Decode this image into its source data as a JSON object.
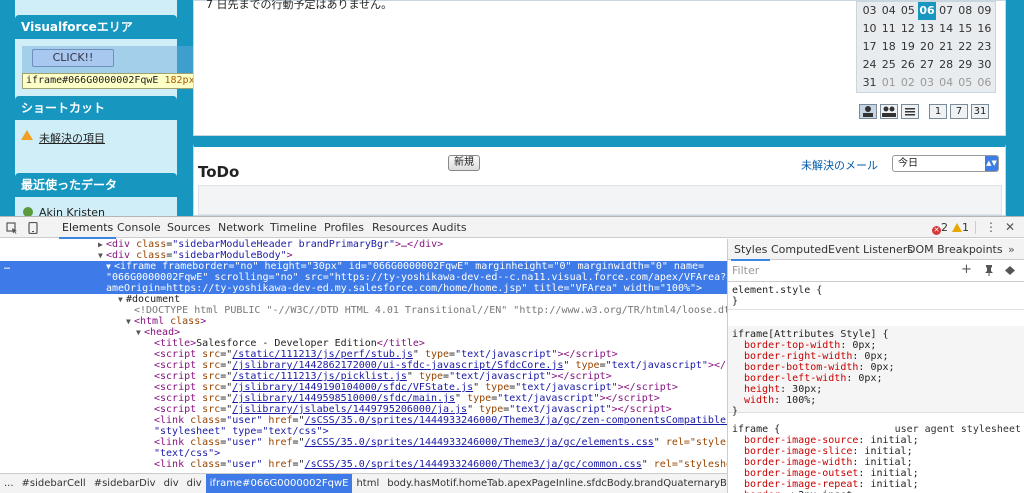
{
  "sidebar": {
    "vf_header": "Visualforceエリア",
    "click_button": "CLICK!!",
    "tooltip": {
      "id": "iframe#066G0000002FqwE",
      "width": "182",
      "height": "30",
      "unit": "px",
      "times": "×"
    },
    "shortcut_header": "ショートカット",
    "shortcut_link": "未解決の項目",
    "recent_header": "最近使ったデータ",
    "recent_item": "Akin Kristen"
  },
  "events": {
    "message": "7 日先までの行動予定はありません。"
  },
  "calendar": {
    "rows": [
      [
        {
          "d": "03"
        },
        {
          "d": "04"
        },
        {
          "d": "05"
        },
        {
          "d": "06",
          "today": true
        },
        {
          "d": "07"
        },
        {
          "d": "08"
        },
        {
          "d": "09"
        }
      ],
      [
        {
          "d": "10"
        },
        {
          "d": "11"
        },
        {
          "d": "12"
        },
        {
          "d": "13"
        },
        {
          "d": "14"
        },
        {
          "d": "15"
        },
        {
          "d": "16"
        }
      ],
      [
        {
          "d": "17"
        },
        {
          "d": "18"
        },
        {
          "d": "19"
        },
        {
          "d": "20"
        },
        {
          "d": "21"
        },
        {
          "d": "22"
        },
        {
          "d": "23"
        }
      ],
      [
        {
          "d": "24"
        },
        {
          "d": "25"
        },
        {
          "d": "26"
        },
        {
          "d": "27"
        },
        {
          "d": "28"
        },
        {
          "d": "29"
        },
        {
          "d": "30"
        }
      ],
      [
        {
          "d": "31"
        },
        {
          "d": "01",
          "muted": true
        },
        {
          "d": "02",
          "muted": true
        },
        {
          "d": "03",
          "muted": true
        },
        {
          "d": "04",
          "muted": true
        },
        {
          "d": "05",
          "muted": true
        },
        {
          "d": "06",
          "muted": true
        }
      ]
    ],
    "day_view": "1",
    "week_view": "7",
    "month_view": "31"
  },
  "todo": {
    "title": "ToDo",
    "new_button": "新規",
    "open_link": "未解決のメール",
    "select_value": "今日"
  },
  "devtools": {
    "tabs": [
      "Elements",
      "Console",
      "Sources",
      "Network",
      "Timeline",
      "Profiles",
      "Resources",
      "Audits"
    ],
    "active_tab": "Elements",
    "errors": "2",
    "warnings": "1",
    "breadcrumbs": [
      "...",
      "#sidebarCell",
      "#sidebarDiv",
      "div",
      "div",
      "iframe#066G0000002FqwE",
      "html",
      "body.hasMotif.homeTab.apexPageInline.sfdcBody.brandQuaternaryBgr",
      "iframe"
    ],
    "active_breadcrumb": 5,
    "styles_tabs": [
      "Styles",
      "Computed",
      "Event Listeners",
      "DOM Breakpoints"
    ],
    "filter_placeholder": "Filter",
    "element_style_selector": "element.style {",
    "iframe_attr_selector": "iframe[Attributes Style] {",
    "iframe_attr_props": [
      {
        "name": "border-top-width",
        "value": "0px;"
      },
      {
        "name": "border-right-width",
        "value": "0px;"
      },
      {
        "name": "border-bottom-width",
        "value": "0px;"
      },
      {
        "name": "border-left-width",
        "value": "0px;"
      },
      {
        "name": "height",
        "value": "30px;"
      },
      {
        "name": "width",
        "value": "100%;"
      }
    ],
    "ua_selector": "iframe {",
    "ua_source": "user agent stylesheet",
    "ua_props": [
      {
        "name": "border-image-source",
        "value": "initial;"
      },
      {
        "name": "border-image-slice",
        "value": "initial;"
      },
      {
        "name": "border-image-width",
        "value": "initial;"
      },
      {
        "name": "border-image-outset",
        "value": "initial;"
      },
      {
        "name": "border-image-repeat",
        "value": "initial;"
      },
      {
        "name": "border",
        "value": "▶2px inset;"
      }
    ],
    "close_brace": "}"
  },
  "dom": {
    "l0": {
      "t1": "<div ",
      "a1": "class",
      "v1": "\"sidebarModuleHeader brandPrimaryBgr\"",
      "t2": ">…</div>"
    },
    "l1": {
      "t1": "<div ",
      "a1": "class",
      "v1": "\"sidebarModuleBody\"",
      "t2": ">"
    },
    "l2a": "<iframe frameborder=\"no\" height=\"30px\" id=\"066G0000002FqwE\" marginheight=\"0\" marginwidth=\"0\" name=",
    "l2b": "\"066G0000002FqwE\" scrolling=\"no\" src=\"https://ty-yoshikawa-dev-ed--c.na11.visual.force.com/apex/VFArea?autoM…",
    "l2c": "ameOrigin=https://ty-yoshikawa-dev-ed.my.salesforce.com/home/home.jsp\" title=\"VFArea\" width=\"100%\">",
    "l3": "#document",
    "l4": "<!DOCTYPE html PUBLIC \"-//W3C//DTD HTML 4.01 Transitional//EN\" \"http://www.w3.org/TR/html4/loose.dtd\">",
    "l5": {
      "t1": "<html ",
      "a1": "class",
      "t2": ">"
    },
    "l6": "<head>",
    "l7": {
      "t1": "<title>",
      "text": "Salesforce - Developer Edition",
      "t2": "</title>"
    },
    "scripts": [
      "/static/111213/js/perf/stub.js",
      "/jslibrary/1442862172000/ui-sfdc-javascript/SfdcCore.js",
      "/static/111213/js/picklist.js",
      "/jslibrary/1449190104000/sfdc/VFState.js",
      "/jslibrary/1449598510000/sfdc/main.js",
      "/jslibrary/jslabels/1449795206000/ja.js"
    ],
    "links": [
      {
        "href": "/sCSS/35.0/sprites/1444933246000/Theme3/ja/gc/zen-componentsCompatible.css",
        "tail": " rel=",
        "wrap": "\"stylesheet\" type=\"text/css\">"
      },
      {
        "href": "/sCSS/35.0/sprites/1444933246000/Theme3/ja/gc/elements.css",
        "tail": " rel=\"stylesheet\" type=",
        "wrap": "\"text/css\">"
      },
      {
        "href": "/sCSS/35.0/sprites/1444933246000/Theme3/ja/gc/common.css",
        "tail": " rel=\"stylesheet\" type=",
        "wrap": ""
      }
    ]
  }
}
